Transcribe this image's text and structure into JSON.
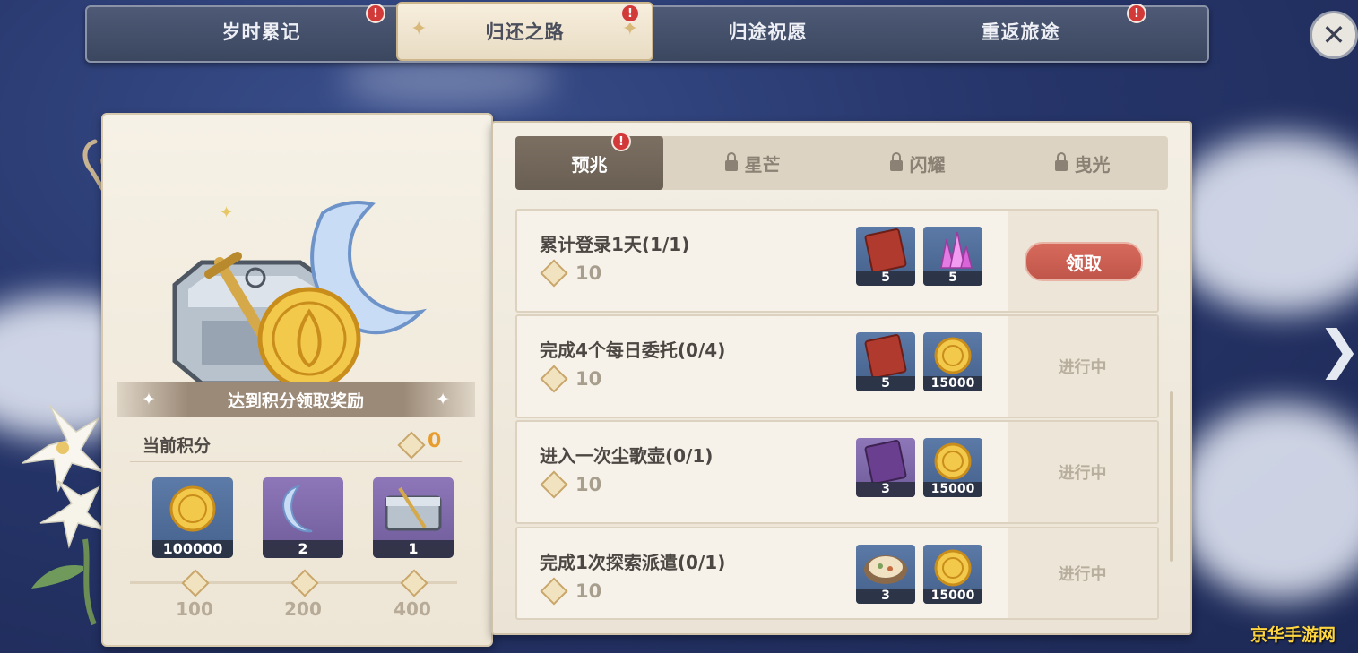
{
  "top_tabs": [
    {
      "label": "岁时累记",
      "active": false,
      "alert": true
    },
    {
      "label": "归还之路",
      "active": true,
      "alert": true
    },
    {
      "label": "归途祝愿",
      "active": false,
      "alert": false
    },
    {
      "label": "重返旅途",
      "active": false,
      "alert": true
    }
  ],
  "alert_mark": "!",
  "close_icon": "close-icon",
  "left_panel": {
    "banner": "达到积分领取奖励",
    "score_label": "当前积分",
    "score_value": "0",
    "tiers": [
      {
        "qty": "100000",
        "points": "100",
        "icon": "mora-coin-icon",
        "rarity": "blue"
      },
      {
        "qty": "2",
        "points": "200",
        "icon": "crescent-moon-icon",
        "rarity": "purple"
      },
      {
        "qty": "1",
        "points": "400",
        "icon": "chest-icon",
        "rarity": "purple"
      }
    ]
  },
  "sub_tabs": [
    {
      "label": "预兆",
      "locked": false,
      "active": true,
      "alert": true
    },
    {
      "label": "星芒",
      "locked": true,
      "active": false
    },
    {
      "label": "闪耀",
      "locked": true,
      "active": false
    },
    {
      "label": "曳光",
      "locked": true,
      "active": false
    }
  ],
  "tasks": [
    {
      "title": "累计登录1天(1/1)",
      "points": "10",
      "rewards": [
        {
          "qty": "5",
          "icon": "red-book-icon",
          "rarity": "blue"
        },
        {
          "qty": "5",
          "icon": "crystal-icon",
          "rarity": "blue"
        }
      ],
      "status": "claim",
      "button_label": "领取"
    },
    {
      "title": "完成4个每日委托(0/4)",
      "points": "10",
      "rewards": [
        {
          "qty": "5",
          "icon": "red-book-icon",
          "rarity": "blue"
        },
        {
          "qty": "15000",
          "icon": "mora-coin-icon",
          "rarity": "blue"
        }
      ],
      "status": "in_progress",
      "button_label": "进行中"
    },
    {
      "title": "进入一次尘歌壶(0/1)",
      "points": "10",
      "rewards": [
        {
          "qty": "3",
          "icon": "purple-book-icon",
          "rarity": "purple"
        },
        {
          "qty": "15000",
          "icon": "mora-coin-icon",
          "rarity": "blue"
        }
      ],
      "status": "in_progress",
      "button_label": "进行中"
    },
    {
      "title": "完成1次探索派遣(0/1)",
      "points": "10",
      "rewards": [
        {
          "qty": "3",
          "icon": "dish-icon",
          "rarity": "blue"
        },
        {
          "qty": "15000",
          "icon": "mora-coin-icon",
          "rarity": "blue"
        }
      ],
      "status": "in_progress",
      "button_label": "进行中"
    }
  ],
  "watermark": "京华手游网",
  "colors": {
    "accent_gold": "#e79c2e",
    "claim_red": "#c9594d",
    "panel_cream": "#f4efe5"
  }
}
